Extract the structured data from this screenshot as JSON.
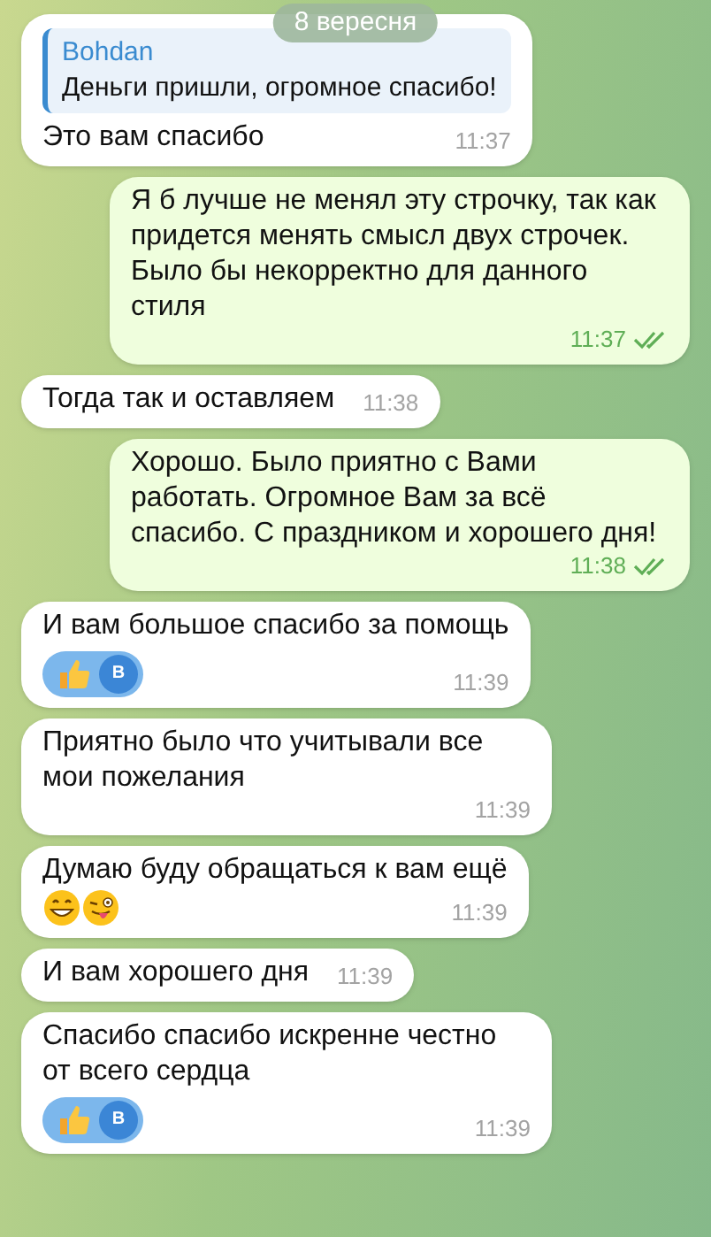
{
  "date_badge": "8 вересня",
  "messages": [
    {
      "kind": "incoming",
      "reply": {
        "author": "Bohdan",
        "text": "Деньги пришли, огромное спасибо!"
      },
      "text": "Это вам спасибо",
      "time": "11:37"
    },
    {
      "kind": "outgoing",
      "text": "Я б лучше не менял эту строчку, так как придется менять смысл двух строчек. Было бы некорректно для данного стиля",
      "time": "11:37",
      "read": true
    },
    {
      "kind": "incoming",
      "text": "Тогда так и оставляем",
      "time": "11:38"
    },
    {
      "kind": "outgoing",
      "text": "Хорошо. Было приятно с Вами работать. Огромное Вам за всё спасибо. С праздником и хорошего дня!",
      "time": "11:38",
      "read": true
    },
    {
      "kind": "incoming",
      "text": "И вам большое спасибо за помощь",
      "time": "11:39",
      "reaction": {
        "kind": "thumbs_up",
        "avatar": "B"
      }
    },
    {
      "kind": "incoming",
      "text": "Приятно было что учитывали все мои пожелания",
      "time": "11:39"
    },
    {
      "kind": "incoming",
      "text": "Думаю буду обращаться к вам ещё",
      "emojis": [
        {
          "kind": "grin"
        },
        {
          "kind": "tongue_wink"
        }
      ],
      "time": "11:39"
    },
    {
      "kind": "incoming",
      "text": "И вам хорошего дня",
      "time": "11:39"
    },
    {
      "kind": "incoming",
      "text": "Спасибо спасибо искренне честно от всего сердца",
      "time": "11:39",
      "reaction": {
        "kind": "thumbs_up",
        "avatar": "B"
      }
    }
  ]
}
